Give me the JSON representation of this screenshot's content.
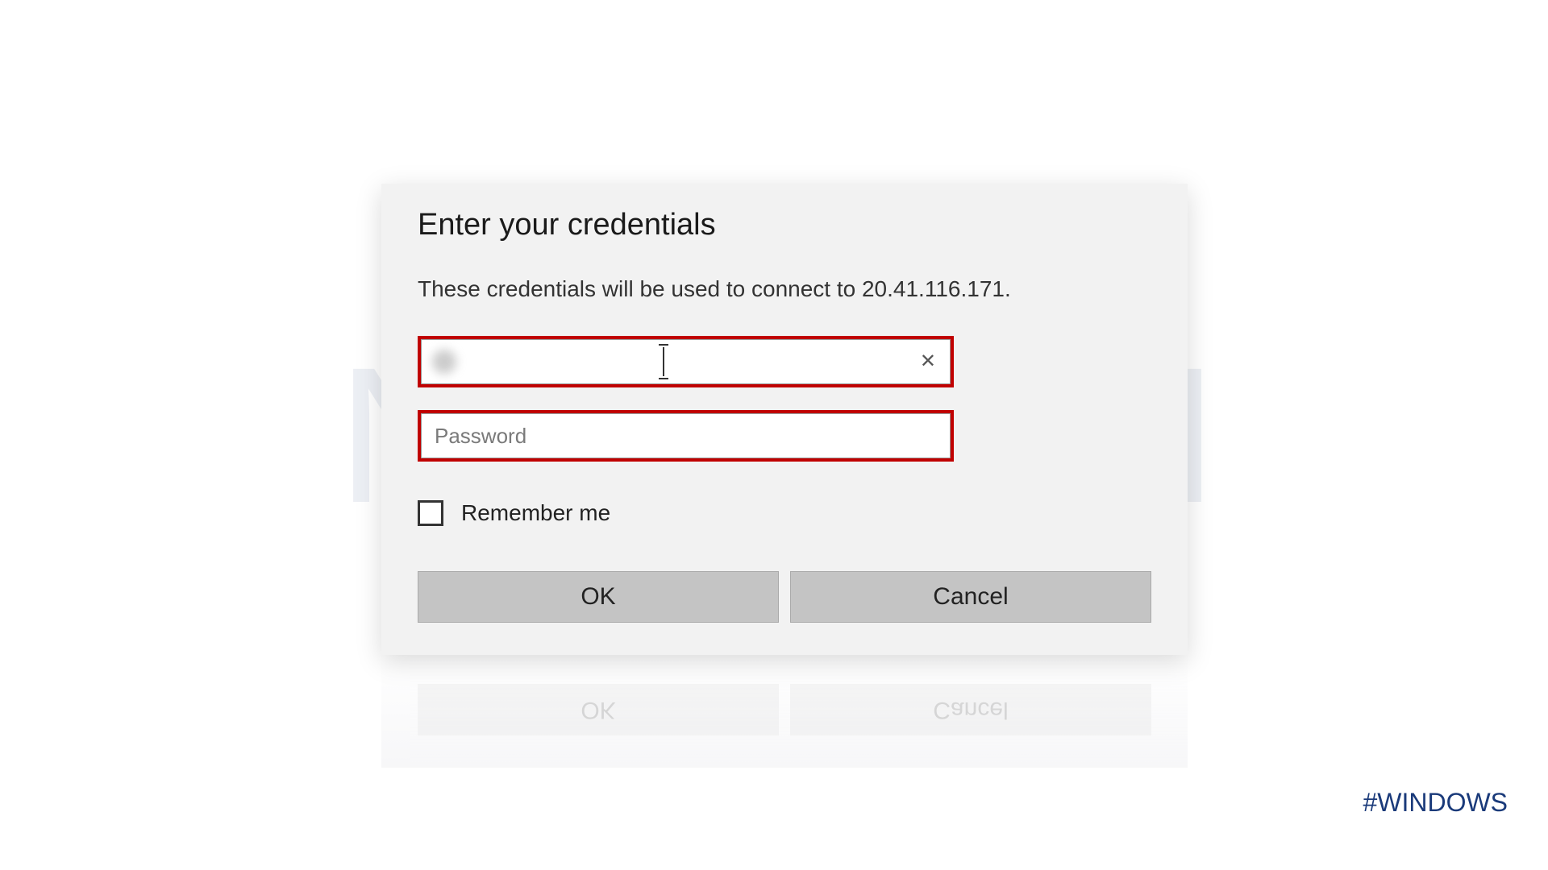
{
  "watermark": "NeuronVM",
  "dialog": {
    "title": "Enter your credentials",
    "description": "These credentials will be used to connect to 20.41.116.171.",
    "username": {
      "value": "",
      "placeholder": ""
    },
    "password": {
      "value": "",
      "placeholder": "Password"
    },
    "remember_label": "Remember me",
    "remember_checked": false,
    "ok_label": "OK",
    "cancel_label": "Cancel"
  },
  "hashtag": "#WINDOWS"
}
